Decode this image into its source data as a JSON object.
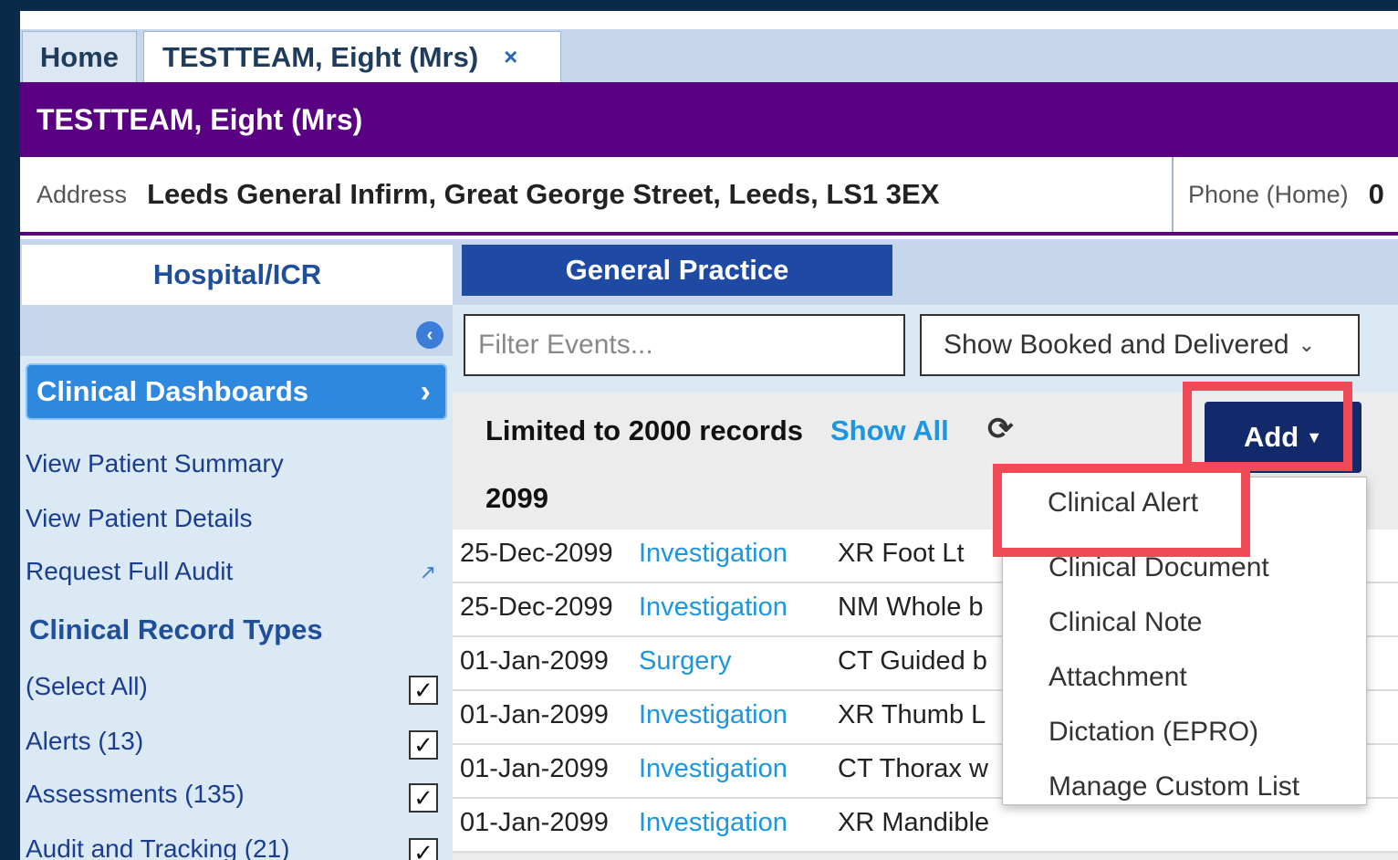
{
  "tabs": [
    {
      "label": "Home"
    },
    {
      "label": "TESTTEAM, Eight (Mrs)",
      "close": "×"
    }
  ],
  "banner": {
    "name": "TESTTEAM, Eight (Mrs)"
  },
  "address": {
    "label": "Address",
    "value": "Leeds General Infirm, Great George Street, Leeds, LS1 3EX",
    "phone_label": "Phone (Home)",
    "phone_value": "0"
  },
  "section_tabs": [
    {
      "label": "Hospital/ICR"
    },
    {
      "label": "General Practice"
    }
  ],
  "sidebar": {
    "dashboard_label": "Clinical Dashboards",
    "links": [
      "View Patient Summary",
      "View Patient Details",
      "Request Full Audit"
    ],
    "record_types_heading": "Clinical Record Types",
    "record_types": [
      {
        "label": "(Select All)",
        "checked": true
      },
      {
        "label": "Alerts (13)",
        "checked": true
      },
      {
        "label": "Assessments (135)",
        "checked": true
      },
      {
        "label": "Audit and Tracking (21)",
        "checked": true
      }
    ]
  },
  "filters": {
    "filter_placeholder": "Filter Events...",
    "status_selected": "Show Booked and Delivered"
  },
  "events": {
    "limited_text": "Limited to 2000 records",
    "show_all": "Show All",
    "add_label": "Add",
    "year": "2099",
    "rows": [
      {
        "date": "25-Dec-2099",
        "type": "Investigation",
        "desc": "XR Foot Lt"
      },
      {
        "date": "25-Dec-2099",
        "type": "Investigation",
        "desc": "NM Whole b"
      },
      {
        "date": "01-Jan-2099",
        "type": "Surgery",
        "desc": "CT Guided b"
      },
      {
        "date": "01-Jan-2099",
        "type": "Investigation",
        "desc": "XR Thumb L"
      },
      {
        "date": "01-Jan-2099",
        "type": "Investigation",
        "desc": "CT Thorax w"
      },
      {
        "date": "01-Jan-2099",
        "type": "Investigation",
        "desc": "XR Mandible"
      }
    ]
  },
  "add_menu": {
    "items": [
      "Clinical Alert",
      "Clinical Document",
      "Clinical Note",
      "Attachment",
      "Dictation (EPRO)",
      "Manage Custom List"
    ]
  },
  "icons": {
    "collapse": "chevron-left-icon",
    "dashboard": "chevron-right-icon",
    "external": "external-link-icon",
    "refresh": "refresh-icon",
    "caret": "caret-down-icon"
  },
  "colors": {
    "banner": "#5a0082",
    "section_active": "#1f4aa3",
    "link": "#1b96e0",
    "highlight": "#ef4b57",
    "add_button": "#122a6c"
  }
}
